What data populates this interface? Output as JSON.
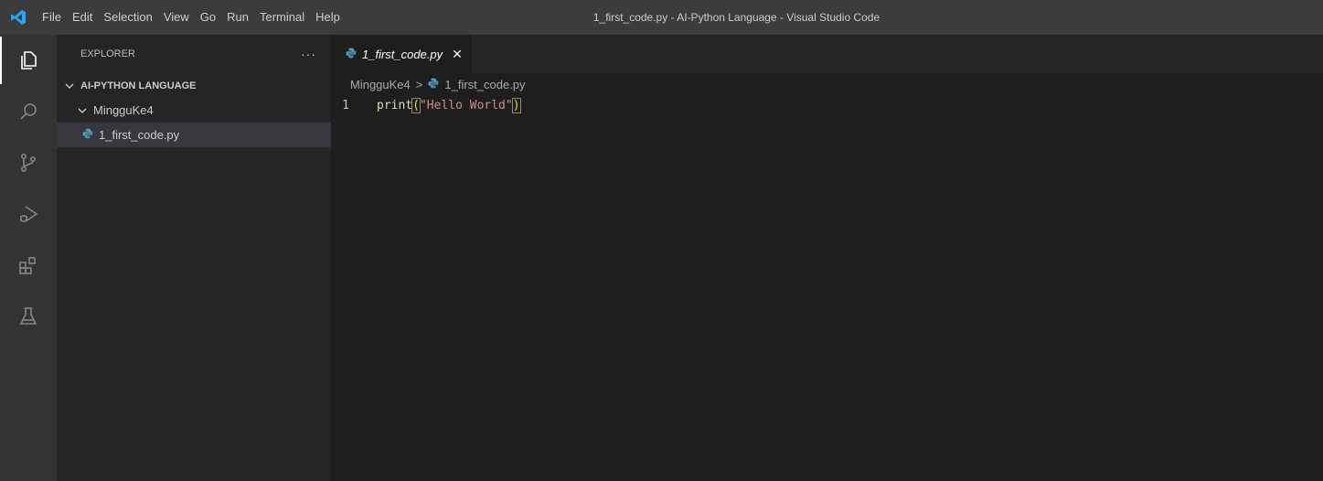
{
  "menu": {
    "items": [
      "File",
      "Edit",
      "Selection",
      "View",
      "Go",
      "Run",
      "Terminal",
      "Help"
    ]
  },
  "window": {
    "title": "1_first_code.py - AI-Python Language - Visual Studio Code"
  },
  "activity_bar": {
    "icons": [
      "explorer-icon",
      "search-icon",
      "source-control-icon",
      "run-debug-icon",
      "extensions-icon",
      "testing-icon"
    ],
    "active": "explorer-icon"
  },
  "sidebar": {
    "header": "EXPLORER",
    "more": "···",
    "section": "AI-PYTHON LANGUAGE",
    "folder": "MingguKe4",
    "file": "1_first_code.py"
  },
  "editor": {
    "tab_label": "1_first_code.py",
    "tab_close": "✕",
    "breadcrumb": [
      "MingguKe4",
      "1_first_code.py"
    ],
    "breadcrumb_sep": ">",
    "lines": [
      {
        "number": "1",
        "fn": "print",
        "open": "(",
        "str": "\"Hello World\"",
        "close": ")"
      }
    ]
  },
  "colors": {
    "accent": "#007acc",
    "titlebar": "#3c3c3c",
    "activitybar": "#333333",
    "sidebar": "#252526",
    "editor": "#1e1e1e",
    "python_icon": "#519aba"
  }
}
